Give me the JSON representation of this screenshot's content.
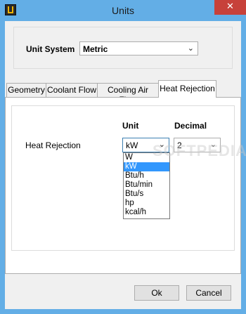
{
  "window": {
    "title": "Units",
    "close_glyph": "✕",
    "app_icon": "app-icon"
  },
  "unit_system": {
    "label": "Unit System",
    "value": "Metric"
  },
  "tabs": [
    {
      "label": "Geometry"
    },
    {
      "label": "Coolant Flow"
    },
    {
      "label": "Cooling Air Flow"
    },
    {
      "label": "Heat Rejection",
      "active": true
    }
  ],
  "panel": {
    "unit_header": "Unit",
    "decimal_header": "Decimal",
    "row_label": "Heat Rejection",
    "unit_value": "kW",
    "decimal_value": "2"
  },
  "unit_options": [
    "W",
    "kW",
    "Btu/h",
    "Btu/min",
    "Btu/s",
    "hp",
    "kcal/h"
  ],
  "buttons": {
    "ok": "Ok",
    "cancel": "Cancel"
  },
  "watermark": "SOFTPEDIA",
  "colors": {
    "frame": "#63aee6",
    "close": "#c7413a",
    "selection": "#3297fd"
  }
}
